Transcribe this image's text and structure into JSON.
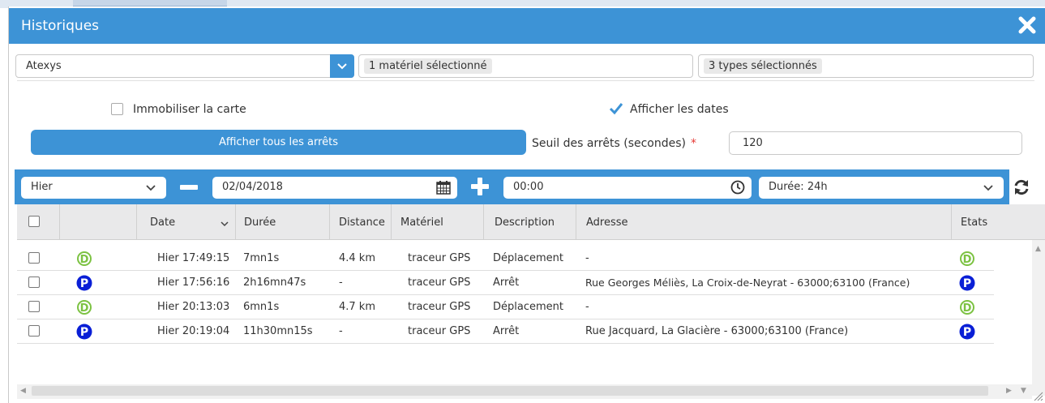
{
  "window": {
    "title": "Historiques"
  },
  "filters": {
    "company": "Atexys",
    "materials": "1 matériel sélectionné",
    "types": "3 types sélectionnés"
  },
  "options": {
    "freeze_map": "Immobiliser la carte",
    "show_dates": "Afficher les dates",
    "show_dates_checked": true,
    "freeze_map_checked": false,
    "show_all_stops": "Afficher tous les arrêts",
    "threshold_label": "Seuil des arrêts (secondes)",
    "threshold_required": "*",
    "threshold_value": "120"
  },
  "toolbar": {
    "period": "Hier",
    "date": "02/04/2018",
    "time": "00:00",
    "duration": "Durée: 24h"
  },
  "table": {
    "columns": [
      "Date",
      "Durée",
      "Distance",
      "Matériel",
      "Description",
      "Adresse",
      "Etats"
    ],
    "rows": [
      {
        "icon": "D",
        "date": "Hier 17:49:15",
        "duree": "7mn1s",
        "distance": "4.4 km",
        "materiel": "traceur GPS",
        "description": "Déplacement",
        "adresse": "-",
        "etat": "D"
      },
      {
        "icon": "P",
        "date": "Hier 17:56:16",
        "duree": "2h16mn47s",
        "distance": "-",
        "materiel": "traceur GPS",
        "description": "Arrêt",
        "adresse": "Rue Georges Méliès, La Croix-de-Neyrat - 63000;63100 (France)",
        "etat": "P"
      },
      {
        "icon": "D",
        "date": "Hier 20:13:03",
        "duree": "6mn1s",
        "distance": "4.7 km",
        "materiel": "traceur GPS",
        "description": "Déplacement",
        "adresse": "-",
        "etat": "D"
      },
      {
        "icon": "P",
        "date": "Hier 20:19:04",
        "duree": "11h30mn15s",
        "distance": "-",
        "materiel": "traceur GPS",
        "description": "Arrêt",
        "adresse": "Rue Jacquard, La Glacière - 63000;63100 (France)",
        "etat": "P"
      }
    ]
  },
  "colors": {
    "accent": "#3d93d6",
    "depart_icon": "#7cc242",
    "parking_icon": "#0a1fd6"
  },
  "icons": [
    "close-icon",
    "chevron-down-icon",
    "minus-icon",
    "calendar-icon",
    "plus-icon",
    "clock-icon",
    "refresh-icon",
    "checkbox-icon",
    "depart-icon",
    "parking-icon"
  ]
}
